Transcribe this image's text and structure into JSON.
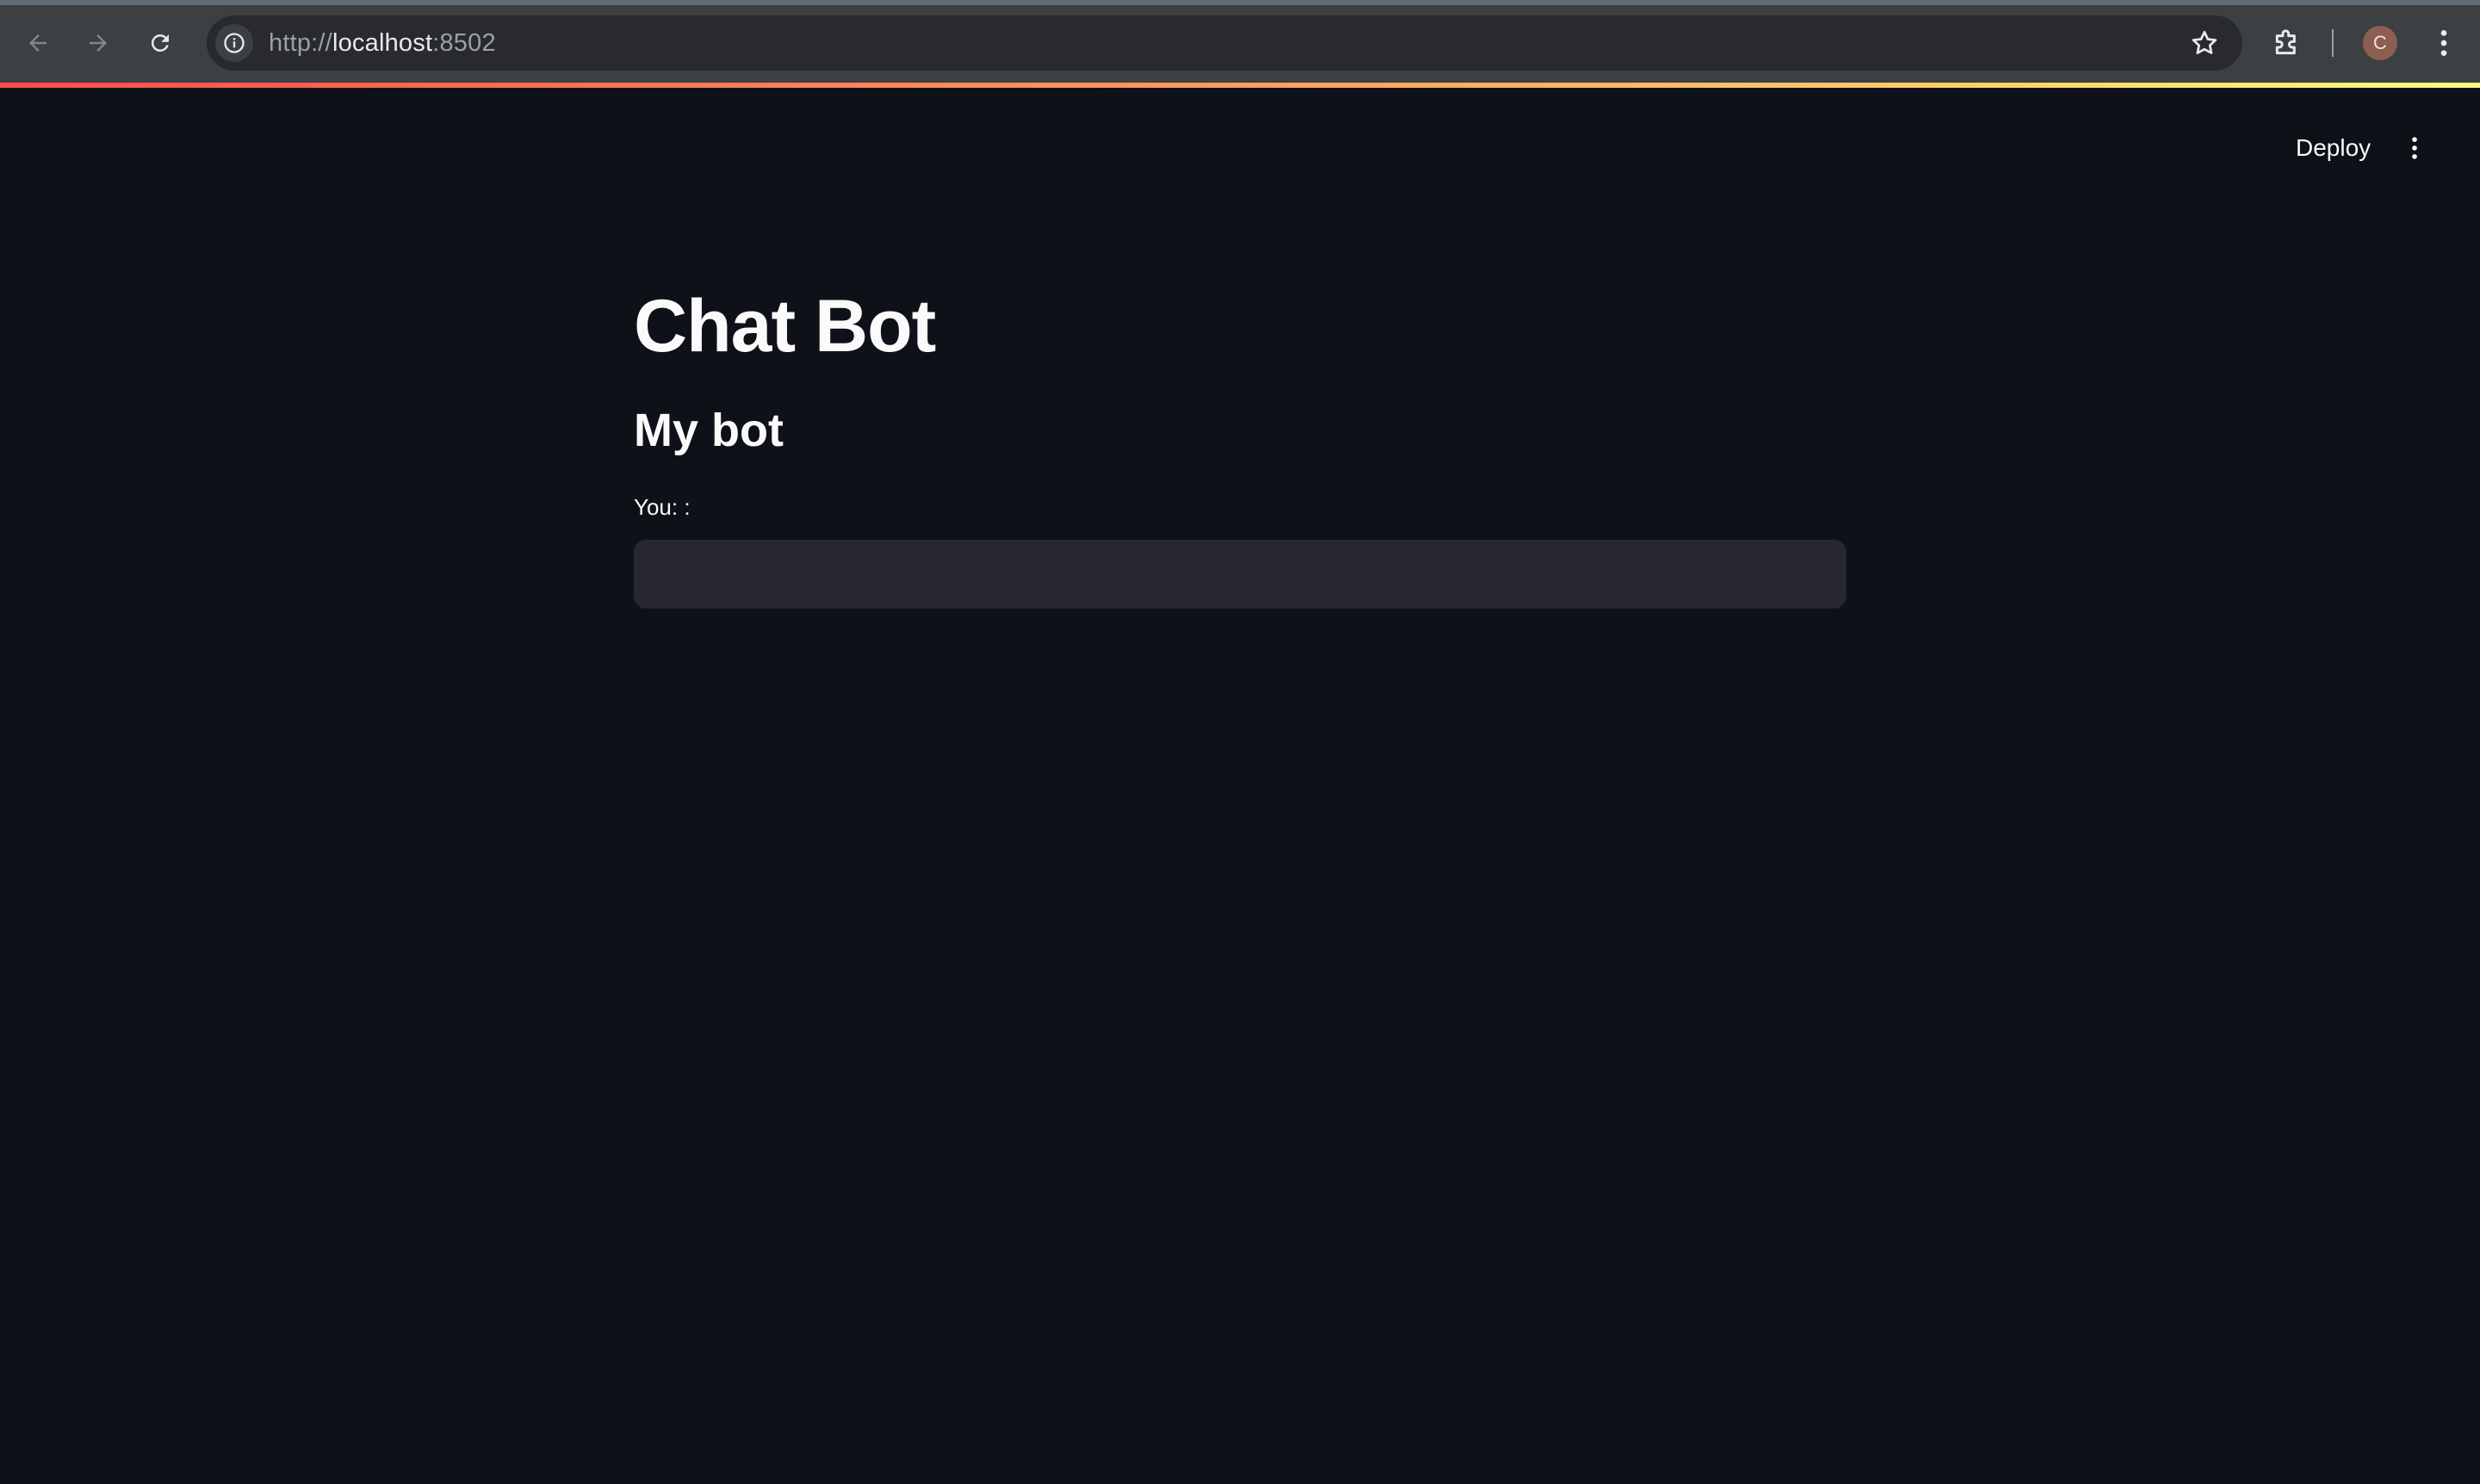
{
  "browser": {
    "url_scheme": "http://",
    "url_host": "localhost",
    "url_port": ":8502",
    "profile_initial": "C"
  },
  "toolbar": {
    "deploy_label": "Deploy"
  },
  "main": {
    "title": "Chat Bot",
    "subheader": "My bot",
    "input_label": "You: :",
    "input_value": ""
  },
  "colors": {
    "background": "#0e1117",
    "input_background": "#262730",
    "text": "#fafafa",
    "browser_bar": "#3c4043"
  }
}
